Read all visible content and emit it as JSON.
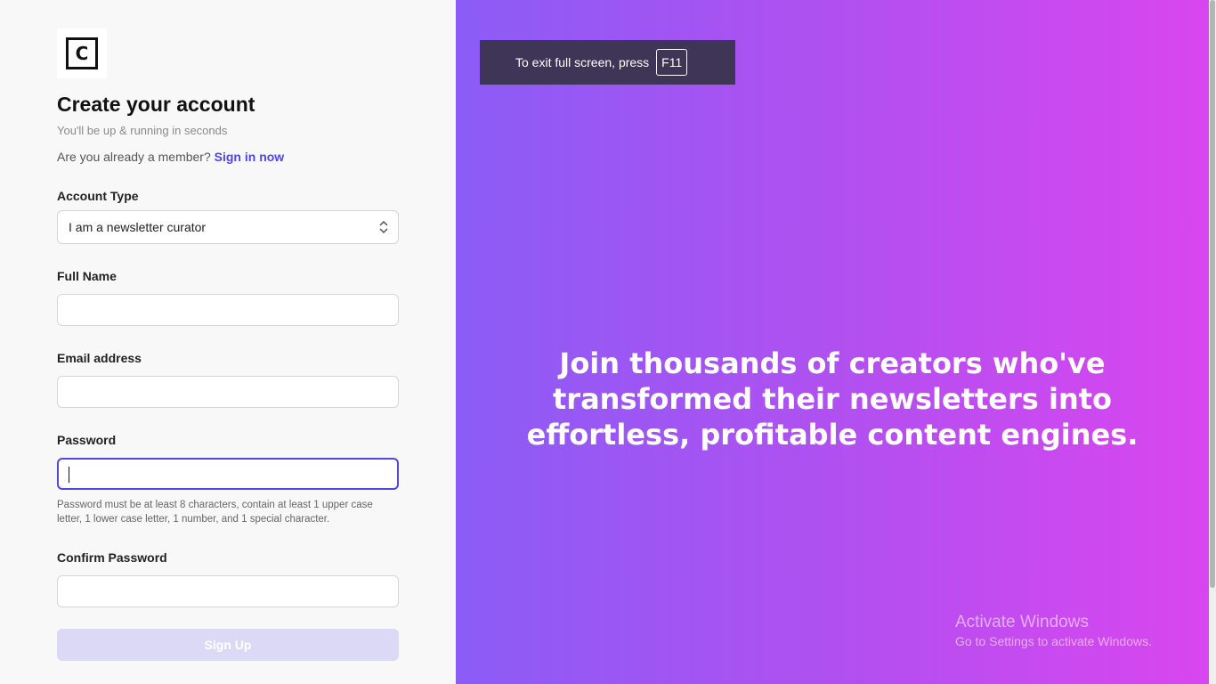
{
  "brand": {
    "logo_letter": "C"
  },
  "header": {
    "title": "Create your account",
    "subtitle": "You'll be up & running in seconds",
    "member_prompt": "Are you already a member?",
    "sign_in_link": "Sign in now"
  },
  "form": {
    "account_type": {
      "label": "Account Type",
      "value": "I am a newsletter curator"
    },
    "full_name": {
      "label": "Full Name",
      "value": ""
    },
    "email": {
      "label": "Email address",
      "value": ""
    },
    "password": {
      "label": "Password",
      "value": "",
      "hint": "Password must be at least 8 characters, contain at least 1 upper case letter, 1 lower case letter, 1 number, and 1 special character."
    },
    "confirm_password": {
      "label": "Confirm Password",
      "value": ""
    },
    "submit_label": "Sign Up"
  },
  "fullscreen_notice": {
    "text": "To exit full screen, press",
    "key": "F11"
  },
  "hero": {
    "text": "Join thousands of creators who've transformed their newsletters into effortless, profitable content engines."
  },
  "watermark": {
    "title": "Activate Windows",
    "subtitle": "Go to Settings to activate Windows."
  },
  "colors": {
    "accent": "#4f46e5",
    "gradient_start": "#8b5cf6",
    "gradient_end": "#d946ef",
    "button_disabled": "#dcd9f7"
  }
}
